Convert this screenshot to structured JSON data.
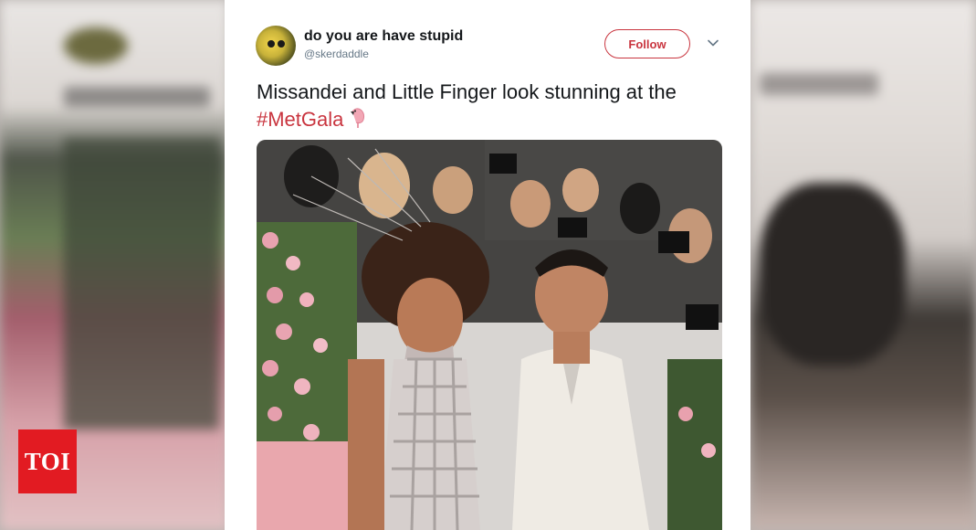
{
  "tweet": {
    "display_name": "do you are have stupid",
    "handle": "@skerdaddle",
    "follow_label": "Follow",
    "text_main": "Missandei and Little Finger look stunning at the ",
    "hashtag": "#MetGala",
    "emoji_icon": "flamingo-icon",
    "menu_icon": "chevron-down-icon"
  },
  "photo": {
    "alt_subject": "photo"
  },
  "brand": {
    "logo_text": "TOI",
    "logo_color": "#e21b22"
  },
  "colors": {
    "accent": "#c9353f",
    "text": "#14171a",
    "muted": "#657786"
  }
}
